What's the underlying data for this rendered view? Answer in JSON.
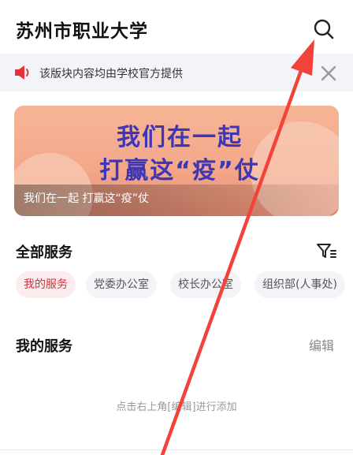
{
  "header": {
    "title": "苏州市职业大学",
    "search_icon": "search-icon"
  },
  "notice": {
    "text": "该版块内容均由学校官方提供",
    "speaker_icon": "speaker-icon",
    "close_icon": "close-icon"
  },
  "banner": {
    "headline_line1": "我们在一起",
    "headline_line2": "打赢这“疫”仗",
    "caption": "我们在一起 打赢这“疫”仗"
  },
  "all_services": {
    "title": "全部服务",
    "filter_icon": "filter-icon",
    "chips": [
      "我的服务",
      "党委办公室",
      "校长办公室",
      "组织部(人事处)"
    ]
  },
  "my_services": {
    "title": "我的服务",
    "edit_label": "编辑",
    "empty_text": "点击右上角[编辑]进行添加"
  },
  "colors": {
    "accent": "#d8303b",
    "notice_bg": "#f3f4f7",
    "annotation_arrow": "#f2433b"
  }
}
